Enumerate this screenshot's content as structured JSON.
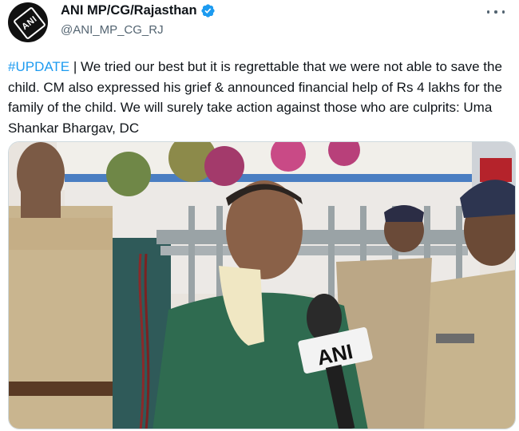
{
  "tweet": {
    "author": {
      "display_name": "ANI MP/CG/Rajasthan",
      "handle": "@ANI_MP_CG_RJ",
      "verified": true,
      "avatar_text": "ANI",
      "avatar_icon": "ani-logo"
    },
    "more_icon": "more-horizontal-icon",
    "text": {
      "hashtag": "#UPDATE",
      "body": " | We tried our best but it is regrettable that we were not able to save the child. CM also expressed his grief & announced financial help of Rs 4 lakhs for the family of the child. We will surely take action against those who are culprits: Uma Shankar Bhargav, DC"
    },
    "media": {
      "mic_logo_text": "ANI"
    }
  },
  "colors": {
    "link": "#1d9bf0",
    "verified_badge": "#1d9bf0",
    "secondary_text": "#536471",
    "primary_text": "#0f1419"
  }
}
